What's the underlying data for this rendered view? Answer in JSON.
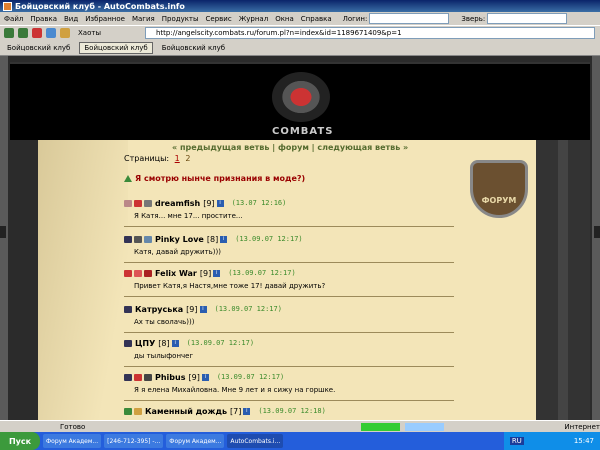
{
  "window": {
    "title": "Бойцовский клуб - AutoCombats.info"
  },
  "menu": {
    "items": [
      "Файл",
      "Правка",
      "Вид",
      "Избранное",
      "Магия",
      "Продукты",
      "Сервис",
      "Журнал",
      "Окна",
      "Справка"
    ],
    "login_label": "Логин:",
    "beast_label": "Зверь:"
  },
  "toolbar": {
    "favorites_label": "Хаоты",
    "address": "http://angelscity.combats.ru/forum.pl?n=index&id=1189671409&p=1"
  },
  "tabs": [
    "Бойцовский клуб",
    "Бойцовский клуб",
    "Бойцовский клуб"
  ],
  "site": {
    "logo_text": "COMBATS",
    "forum_label": "ФОРУМ",
    "nav": {
      "prev": "« предыдущая ветвь",
      "forum": "форум",
      "next": "следующая ветвь »",
      "sep": "|"
    },
    "pages_label": "Страницы:",
    "pages": [
      "1",
      "2"
    ],
    "topic_title": "Я смотрю нынче признания в моде?)"
  },
  "posts": [
    {
      "name": "dreamfish",
      "level": "[9]",
      "time": "(13.07 12:16)",
      "message": "Я Катя... мне 17... простите..."
    },
    {
      "name": "Pinky Love",
      "level": "[8]",
      "time": "(13.09.07 12:17)",
      "message": "Катя, давай дружить)))"
    },
    {
      "name": "Felix War",
      "level": "[9]",
      "time": "(13.09.07 12:17)",
      "message": "Привет Катя,я Настя,мне тоже 17! давай дружить?"
    },
    {
      "name": "Катруська",
      "level": "[9]",
      "time": "(13.09.07 12:17)",
      "message": "Ах ты сволачь)))"
    },
    {
      "name": "ЦПУ",
      "level": "[8]",
      "time": "(13.09.07 12:17)",
      "message": "ды тылыфончег"
    },
    {
      "name": "Phibus",
      "level": "[9]",
      "time": "(13.09.07 12:17)",
      "message": "Я я елена Михайловна. Мне 9 лет и я сижу на горшке."
    },
    {
      "name": "Каменный дождь",
      "level": "[7]",
      "time": "(13.09.07 12:18)",
      "message": ""
    }
  ],
  "status": {
    "text": "Готово",
    "zone": "Интернет"
  },
  "taskbar": {
    "start": "Пуск",
    "tasks": [
      "Форум Академ...",
      "[246-712-395] -...",
      "Форум Академ...",
      "AutoCombats.i..."
    ],
    "lang": "RU",
    "clock": "15:47"
  }
}
